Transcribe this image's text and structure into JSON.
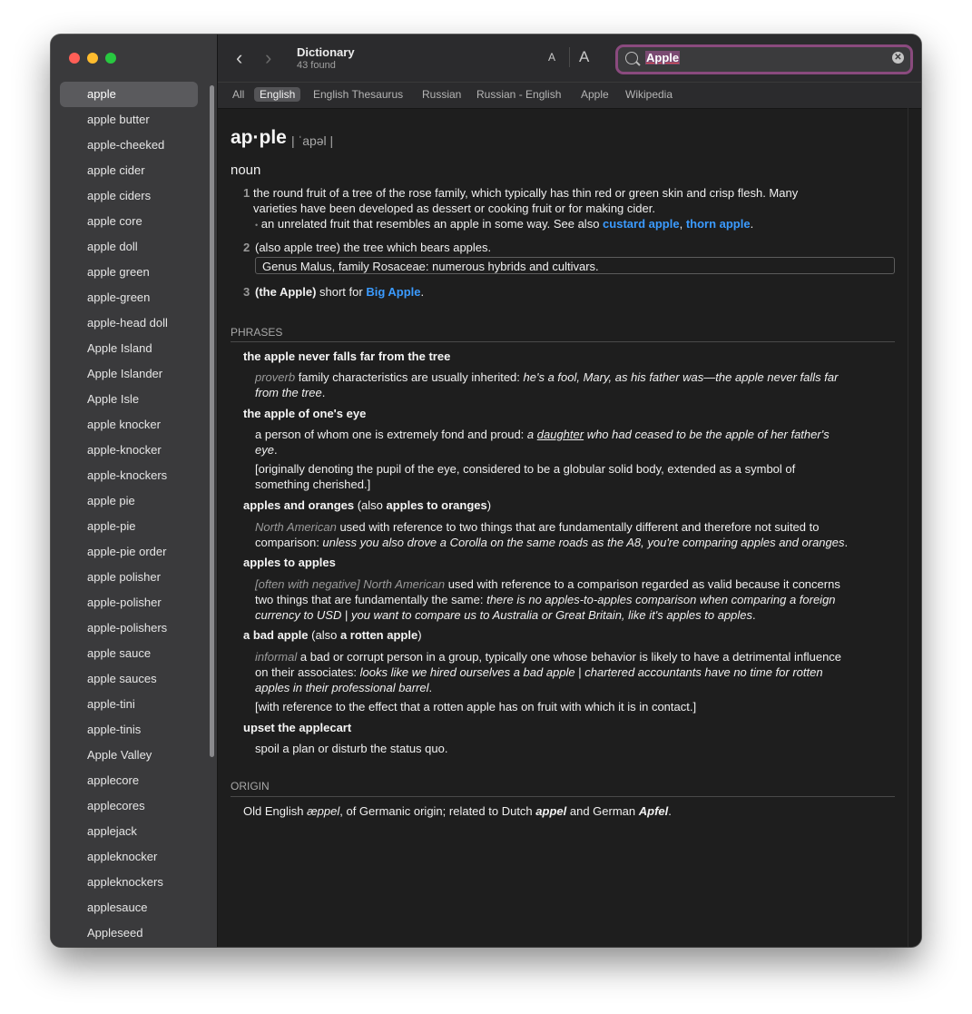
{
  "sidebar": {
    "words": [
      "apple",
      "apple butter",
      "apple-cheeked",
      "apple cider",
      "apple ciders",
      "apple core",
      "apple doll",
      "apple green",
      "apple-green",
      "apple-head doll",
      "Apple Island",
      "Apple Islander",
      "Apple Isle",
      "apple knocker",
      "apple-knocker",
      "apple-knockers",
      "apple pie",
      "apple-pie",
      "apple-pie order",
      "apple polisher",
      "apple-polisher",
      "apple-polishers",
      "apple sauce",
      "apple sauces",
      "apple-tini",
      "apple-tinis",
      "Apple Valley",
      "applecore",
      "applecores",
      "applejack",
      "appleknocker",
      "appleknockers",
      "applesauce",
      "Appleseed"
    ],
    "selected_index": 0
  },
  "toolbar": {
    "title": "Dictionary",
    "found": "43 found",
    "back_glyph": "‹",
    "forward_glyph": "›",
    "font_small_label": "A",
    "font_large_label": "A",
    "search_value": "Apple"
  },
  "tabs": {
    "all": "All",
    "english": "English",
    "thesaurus": "English Thesaurus",
    "russian": "Russian",
    "russian_english": "Russian - English",
    "apple": "Apple",
    "wikipedia": "Wikipedia"
  },
  "entry": {
    "headword": "ap·ple",
    "pronunciation": "| ˈapəl |",
    "pos": "noun",
    "sense1": {
      "num": "1",
      "line1": "the round fruit of a tree of the rose family, which typically has thin red or green skin and crisp flesh. Many",
      "line2": "varieties have been developed as dessert or cooking fruit or for making cider.",
      "sub_bullet": "•",
      "sub": "an unrelated fruit that resembles an apple in some way. See also ",
      "link1": "custard apple",
      "sep": ", ",
      "link2": "thorn apple",
      "end": "."
    },
    "sense2": {
      "num": "2",
      "text": "(also apple tree) the tree which bears apples.",
      "box": "Genus Malus, family Rosaceae: numerous hybrids and cultivars."
    },
    "sense3": {
      "num": "3",
      "bold": "(the Apple)",
      "text": " short for ",
      "link": "Big Apple",
      "end": "."
    }
  },
  "phrases": {
    "heading": "PHRASES",
    "p1": {
      "title": "the apple never falls far from the tree",
      "label": "proverb",
      "def": " family characteristics are usually inherited: ",
      "ex1": "he's a fool, Mary, as his father was—the apple never falls far",
      "ex2": "from the tree",
      "end": "."
    },
    "p2": {
      "title": "the apple of one's eye",
      "def": "a person of whom one is extremely fond and proud: ",
      "ex_a": "a ",
      "ex_ul": "daughter",
      "ex_b": " who had ceased to be the apple of her father's",
      "ex2": "eye",
      "end": ".",
      "note1": "[originally denoting the pupil of the eye, considered to be a globular solid body, extended as a symbol of",
      "note2": "something cherished.]"
    },
    "p3": {
      "title": "apples and oranges",
      "also_a": " (also ",
      "also_b": "apples to oranges",
      "also_c": ")",
      "label": "North American",
      "def1": " used with reference to two things that are fundamentally different and therefore not suited to",
      "def2": "comparison: ",
      "ex": "unless you also drove a Corolla on the same roads as the A8, you're comparing apples and oranges",
      "end": "."
    },
    "p4": {
      "title": "apples to apples",
      "label": "[often with negative] North American",
      "def1": " used with reference to a comparison regarded as valid because it concerns",
      "def2": "two things that are fundamentally the same: ",
      "ex1": "there is no apples-to-apples comparison when comparing a foreign",
      "ex2": "currency to USD",
      "sep": " | ",
      "ex3": "you want to compare us to Australia or Great Britain, like it's apples to apples",
      "end": "."
    },
    "p5": {
      "title": "a bad apple",
      "also_a": " (also ",
      "also_b": "a rotten apple",
      "also_c": ")",
      "label": "informal",
      "def1": " a bad or corrupt person in a group, typically one whose behavior is likely to have a detrimental influence",
      "def2": "on their associates: ",
      "ex1": "looks like we hired ourselves a bad apple",
      "sep": " | ",
      "ex2": "chartered accountants have no time for rotten",
      "ex3": "apples in their professional barrel",
      "end": ".",
      "note": "[with reference to the effect that a rotten apple has on fruit with which it is in contact.]"
    },
    "p6": {
      "title": "upset the applecart",
      "def": "spoil a plan or disturb the status quo."
    }
  },
  "origin": {
    "heading": "ORIGIN",
    "t1": "Old English ",
    "w1": "æppel",
    "t2": ", of Germanic origin; related to Dutch ",
    "w2": "appel",
    "t3": " and German ",
    "w3": "Apfel",
    "t4": "."
  }
}
